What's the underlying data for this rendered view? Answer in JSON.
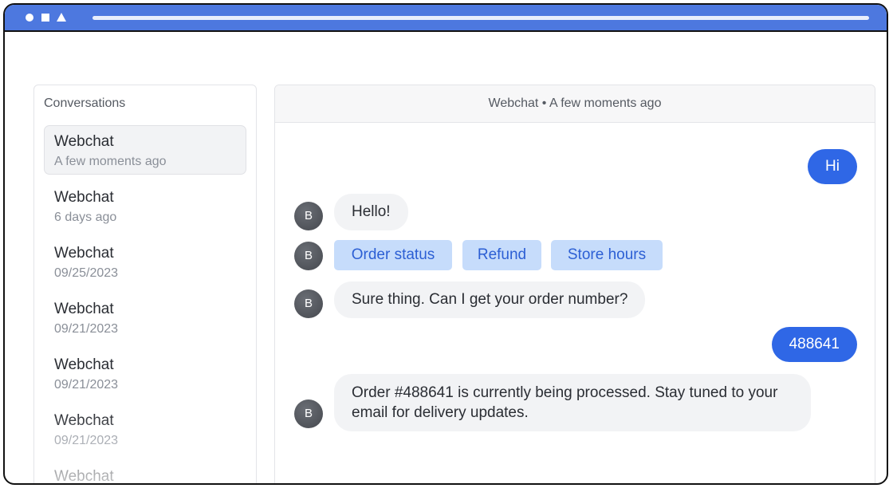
{
  "window": {
    "controls": [
      "circle-icon",
      "square-icon",
      "triangle-icon"
    ]
  },
  "sidebar": {
    "heading": "Conversations",
    "items": [
      {
        "title": "Webchat",
        "subtitle": "A few moments ago",
        "active": true
      },
      {
        "title": "Webchat",
        "subtitle": "6 days ago"
      },
      {
        "title": "Webchat",
        "subtitle": "09/25/2023"
      },
      {
        "title": "Webchat",
        "subtitle": "09/21/2023"
      },
      {
        "title": "Webchat",
        "subtitle": "09/21/2023"
      },
      {
        "title": "Webchat",
        "subtitle": "09/21/2023"
      },
      {
        "title": "Webchat",
        "subtitle": ""
      }
    ]
  },
  "chat": {
    "header": "Webchat • A few moments ago",
    "bot_avatar_letter": "B",
    "messages": [
      {
        "from": "user",
        "text": "Hi"
      },
      {
        "from": "bot",
        "text": "Hello!"
      },
      {
        "from": "bot",
        "type": "quick_replies",
        "options": [
          "Order status",
          "Refund",
          "Store hours"
        ]
      },
      {
        "from": "bot",
        "text": "Sure thing. Can I get your order number?"
      },
      {
        "from": "user",
        "text": "488641"
      },
      {
        "from": "bot",
        "text": "Order #488641 is currently being processed. Stay tuned to your email for delivery updates."
      }
    ]
  },
  "colors": {
    "titlebar": "#4d78df",
    "user_bubble": "#2f67e6",
    "chip_bg": "#c6dcfb",
    "chip_text": "#2c5fd4",
    "bot_bubble": "#f2f3f5"
  }
}
